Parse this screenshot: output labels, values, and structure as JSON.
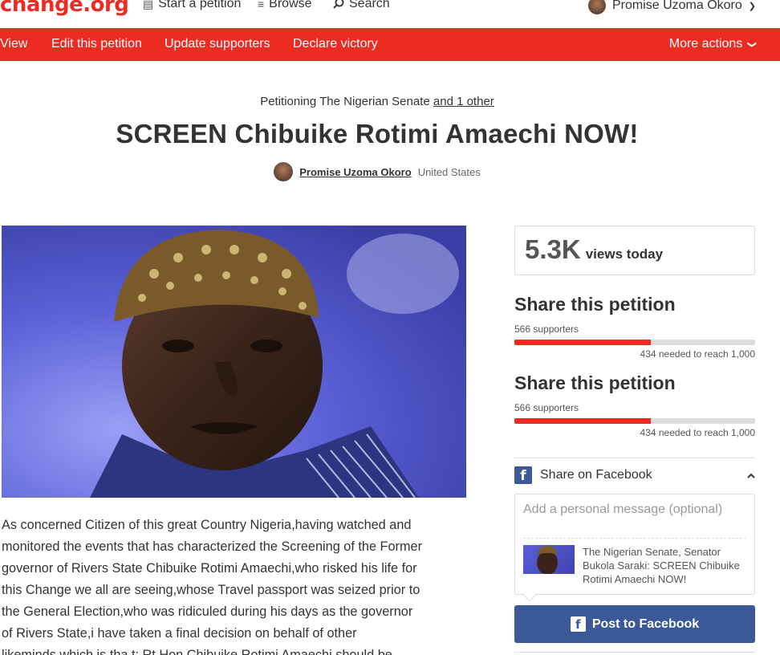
{
  "header": {
    "logo": "change.org",
    "nav": [
      {
        "label": "Start a petition",
        "icon": "document-icon"
      },
      {
        "label": "Browse",
        "icon": "list-icon"
      },
      {
        "label": "Search",
        "icon": "search-icon"
      }
    ],
    "user_name": "Promise Uzoma Okoro"
  },
  "toolbar": {
    "items": [
      "View",
      "Edit this petition",
      "Update supporters",
      "Declare victory"
    ],
    "more_actions": "More actions"
  },
  "petition": {
    "petitioning_prefix": "Petitioning The Nigerian Senate",
    "petitioning_link": "and 1 other",
    "title": "SCREEN Chibuike Rotimi Amaechi NOW!",
    "author": "Promise Uzoma Okoro",
    "location": "United States",
    "body_lines": [
      " As concerned Citizen of this great Country Nigeria,having watched and",
      "monitored the events that has characterized the Screening of the Former",
      "governor of Rivers State Chibuike Rotimi Amaechi,who risked his life for",
      "this Change we all are seeing,whose Travel passport was seized prior to",
      "the General Election,who was ridiculed during his days as the governor",
      "of Rivers State,i have taken a final decision on behalf of other",
      "likeminds which is tha t: Rt Hon Chibuike Rotimi Amaechi should be"
    ]
  },
  "sidebar": {
    "views_number": "5.3K",
    "views_label": "views today",
    "share_blocks": [
      {
        "title": "Share this petition",
        "supporters": "566 supporters",
        "needed": "434 needed to reach 1,000",
        "progress": 0.566
      },
      {
        "title": "Share this petition",
        "supporters": "566 supporters",
        "needed": "434 needed to reach 1,000",
        "progress": 0.566
      }
    ],
    "facebook": {
      "header": "Share on Facebook",
      "placeholder": "Add a personal message (optional)",
      "preview": "The Nigerian Senate, Senator Bukola Saraki: SCREEN Chibuike Rotimi Amaechi NOW!",
      "post_button": "Post to Facebook"
    }
  },
  "colors": {
    "brand_red": "#ec2c22",
    "facebook_blue": "#3b5998"
  }
}
